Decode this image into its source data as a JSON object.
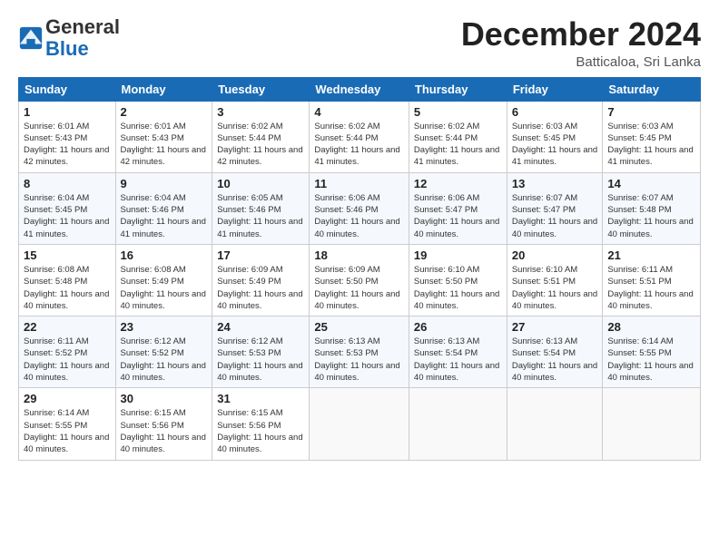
{
  "logo": {
    "general": "General",
    "blue": "Blue"
  },
  "header": {
    "month": "December 2024",
    "location": "Batticaloa, Sri Lanka"
  },
  "weekdays": [
    "Sunday",
    "Monday",
    "Tuesday",
    "Wednesday",
    "Thursday",
    "Friday",
    "Saturday"
  ],
  "weeks": [
    [
      {
        "day": "1",
        "sunrise": "6:01 AM",
        "sunset": "5:43 PM",
        "daylight": "11 hours and 42 minutes."
      },
      {
        "day": "2",
        "sunrise": "6:01 AM",
        "sunset": "5:43 PM",
        "daylight": "11 hours and 42 minutes."
      },
      {
        "day": "3",
        "sunrise": "6:02 AM",
        "sunset": "5:44 PM",
        "daylight": "11 hours and 42 minutes."
      },
      {
        "day": "4",
        "sunrise": "6:02 AM",
        "sunset": "5:44 PM",
        "daylight": "11 hours and 41 minutes."
      },
      {
        "day": "5",
        "sunrise": "6:02 AM",
        "sunset": "5:44 PM",
        "daylight": "11 hours and 41 minutes."
      },
      {
        "day": "6",
        "sunrise": "6:03 AM",
        "sunset": "5:45 PM",
        "daylight": "11 hours and 41 minutes."
      },
      {
        "day": "7",
        "sunrise": "6:03 AM",
        "sunset": "5:45 PM",
        "daylight": "11 hours and 41 minutes."
      }
    ],
    [
      {
        "day": "8",
        "sunrise": "6:04 AM",
        "sunset": "5:45 PM",
        "daylight": "11 hours and 41 minutes."
      },
      {
        "day": "9",
        "sunrise": "6:04 AM",
        "sunset": "5:46 PM",
        "daylight": "11 hours and 41 minutes."
      },
      {
        "day": "10",
        "sunrise": "6:05 AM",
        "sunset": "5:46 PM",
        "daylight": "11 hours and 41 minutes."
      },
      {
        "day": "11",
        "sunrise": "6:06 AM",
        "sunset": "5:46 PM",
        "daylight": "11 hours and 40 minutes."
      },
      {
        "day": "12",
        "sunrise": "6:06 AM",
        "sunset": "5:47 PM",
        "daylight": "11 hours and 40 minutes."
      },
      {
        "day": "13",
        "sunrise": "6:07 AM",
        "sunset": "5:47 PM",
        "daylight": "11 hours and 40 minutes."
      },
      {
        "day": "14",
        "sunrise": "6:07 AM",
        "sunset": "5:48 PM",
        "daylight": "11 hours and 40 minutes."
      }
    ],
    [
      {
        "day": "15",
        "sunrise": "6:08 AM",
        "sunset": "5:48 PM",
        "daylight": "11 hours and 40 minutes."
      },
      {
        "day": "16",
        "sunrise": "6:08 AM",
        "sunset": "5:49 PM",
        "daylight": "11 hours and 40 minutes."
      },
      {
        "day": "17",
        "sunrise": "6:09 AM",
        "sunset": "5:49 PM",
        "daylight": "11 hours and 40 minutes."
      },
      {
        "day": "18",
        "sunrise": "6:09 AM",
        "sunset": "5:50 PM",
        "daylight": "11 hours and 40 minutes."
      },
      {
        "day": "19",
        "sunrise": "6:10 AM",
        "sunset": "5:50 PM",
        "daylight": "11 hours and 40 minutes."
      },
      {
        "day": "20",
        "sunrise": "6:10 AM",
        "sunset": "5:51 PM",
        "daylight": "11 hours and 40 minutes."
      },
      {
        "day": "21",
        "sunrise": "6:11 AM",
        "sunset": "5:51 PM",
        "daylight": "11 hours and 40 minutes."
      }
    ],
    [
      {
        "day": "22",
        "sunrise": "6:11 AM",
        "sunset": "5:52 PM",
        "daylight": "11 hours and 40 minutes."
      },
      {
        "day": "23",
        "sunrise": "6:12 AM",
        "sunset": "5:52 PM",
        "daylight": "11 hours and 40 minutes."
      },
      {
        "day": "24",
        "sunrise": "6:12 AM",
        "sunset": "5:53 PM",
        "daylight": "11 hours and 40 minutes."
      },
      {
        "day": "25",
        "sunrise": "6:13 AM",
        "sunset": "5:53 PM",
        "daylight": "11 hours and 40 minutes."
      },
      {
        "day": "26",
        "sunrise": "6:13 AM",
        "sunset": "5:54 PM",
        "daylight": "11 hours and 40 minutes."
      },
      {
        "day": "27",
        "sunrise": "6:13 AM",
        "sunset": "5:54 PM",
        "daylight": "11 hours and 40 minutes."
      },
      {
        "day": "28",
        "sunrise": "6:14 AM",
        "sunset": "5:55 PM",
        "daylight": "11 hours and 40 minutes."
      }
    ],
    [
      {
        "day": "29",
        "sunrise": "6:14 AM",
        "sunset": "5:55 PM",
        "daylight": "11 hours and 40 minutes."
      },
      {
        "day": "30",
        "sunrise": "6:15 AM",
        "sunset": "5:56 PM",
        "daylight": "11 hours and 40 minutes."
      },
      {
        "day": "31",
        "sunrise": "6:15 AM",
        "sunset": "5:56 PM",
        "daylight": "11 hours and 40 minutes."
      },
      null,
      null,
      null,
      null
    ]
  ]
}
